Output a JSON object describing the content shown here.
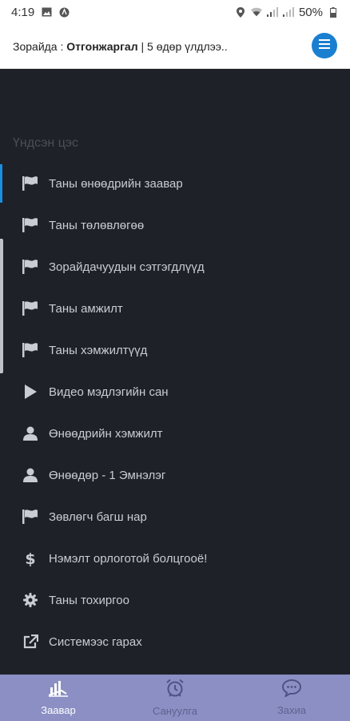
{
  "status_bar": {
    "time": "4:19",
    "battery": "50%"
  },
  "header": {
    "prefix": "Зорайда : ",
    "user_name": "Отгонжаргал",
    "suffix": " | 5 өдөр үлдлээ.."
  },
  "sidebar": {
    "section_label": "Үндсэн цэс",
    "items": [
      {
        "label": "Таны өнөөдрийн заавар",
        "icon": "flag-icon"
      },
      {
        "label": "Таны төлөвлөгөө",
        "icon": "flag-icon"
      },
      {
        "label": "Зорайдачуудын сэтгэгдлүүд",
        "icon": "flag-icon"
      },
      {
        "label": "Таны амжилт",
        "icon": "flag-icon"
      },
      {
        "label": "Таны хэмжилтүүд",
        "icon": "flag-icon"
      },
      {
        "label": "Видео мэдлэгийн сан",
        "icon": "play-icon"
      },
      {
        "label": "Өнөөдрийн хэмжилт",
        "icon": "user-icon"
      },
      {
        "label": "Өнөөдөр - 1 Эмнэлэг",
        "icon": "user-icon"
      },
      {
        "label": "Зөвлөгч багш нар",
        "icon": "flag-icon"
      },
      {
        "label": "Нэмэлт орлоготой болцгооё!",
        "icon": "dollar-icon"
      },
      {
        "label": "Таны тохиргоо",
        "icon": "gear-icon"
      },
      {
        "label": "Системээс гарах",
        "icon": "external-link-icon"
      }
    ]
  },
  "bottom_nav": {
    "items": [
      {
        "label": "Заавар",
        "icon": "chart-icon"
      },
      {
        "label": "Сануулга",
        "icon": "alarm-clock-icon"
      },
      {
        "label": "Захиа",
        "icon": "chat-icon"
      }
    ]
  },
  "colors": {
    "accent": "#1a7fd0",
    "sidebar_bg": "#1e2128",
    "bottom_nav_bg": "#8b8fc4"
  }
}
